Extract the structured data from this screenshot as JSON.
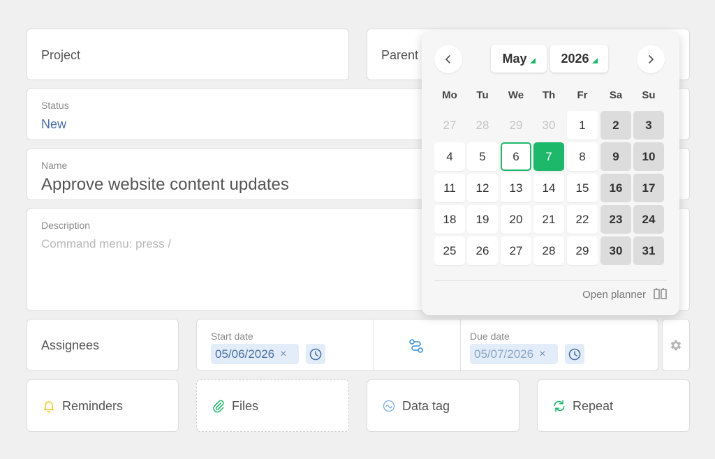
{
  "fields": {
    "project": "Project",
    "parent": "Parent",
    "status_label": "Status",
    "status_value": "New",
    "name_label": "Name",
    "name_value": "Approve website content updates",
    "description_label": "Description",
    "description_placeholder": "Command menu: press /",
    "assignees": "Assignees"
  },
  "dates": {
    "start_label": "Start date",
    "start_value": "05/06/2026",
    "due_label": "Due date",
    "due_value": "05/07/2026",
    "clear_symbol": "×"
  },
  "actions": {
    "reminders": "Reminders",
    "files": "Files",
    "data_tag": "Data tag",
    "repeat": "Repeat"
  },
  "calendar": {
    "month": "May",
    "year": "2026",
    "weekdays": [
      "Mo",
      "Tu",
      "We",
      "Th",
      "Fr",
      "Sa",
      "Su"
    ],
    "weeks": [
      [
        "27",
        "28",
        "29",
        "30",
        "1",
        "2",
        "3"
      ],
      [
        "4",
        "5",
        "6",
        "7",
        "8",
        "9",
        "10"
      ],
      [
        "11",
        "12",
        "13",
        "14",
        "15",
        "16",
        "17"
      ],
      [
        "18",
        "19",
        "20",
        "21",
        "22",
        "23",
        "24"
      ],
      [
        "25",
        "26",
        "27",
        "28",
        "29",
        "30",
        "31"
      ]
    ],
    "today": "6",
    "selected": "7",
    "open_planner": "Open planner"
  },
  "colors": {
    "accent": "#1eb86a",
    "link_blue": "#4a6fa5",
    "reminder_icon": "#f2c21b",
    "repeat_icon": "#1eb86a"
  }
}
